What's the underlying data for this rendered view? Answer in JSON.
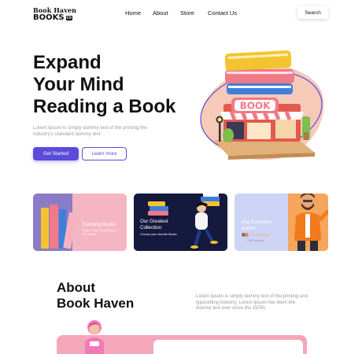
{
  "nav": {
    "logo_line1": "Book Haven",
    "logo_line2": "BOOKS",
    "logo_badge": "CO",
    "links": [
      "Home",
      "About",
      "Store",
      "Contact Us"
    ],
    "search_label": "Search"
  },
  "hero": {
    "title_lines": [
      "Expand",
      "Your Mind",
      "Reading a Book"
    ],
    "description": "Lorem Ipsum is simply dummy text of the printing the industry's standard dummy text.",
    "primary_button": "Get Started",
    "secondary_button": "Learn more",
    "illustration_sign": "BOOK"
  },
  "cards": [
    {
      "title": "Trending Books",
      "subtitle": "Explore Trending Books of The Month"
    },
    {
      "title": "Our Greatest Collection",
      "subtitle": "Choose your favorite Books"
    },
    {
      "title": "Our Exclusive author",
      "subtitle": "4.8 ★★★★★",
      "note": "1.4K reviews"
    }
  ],
  "about": {
    "title_lines": [
      "About",
      "Book Haven"
    ],
    "description": "Lorem Ipsum is simply dummy text of the printing and typesetting industry. Lorem Ipsum has been the dummy text ever since the 1500s."
  },
  "colors": {
    "accent": "#5b4bdb",
    "pink": "#f5b6c3",
    "navy": "#15193d",
    "lavender": "#cdd3f5",
    "orange": "#f5a55c"
  }
}
